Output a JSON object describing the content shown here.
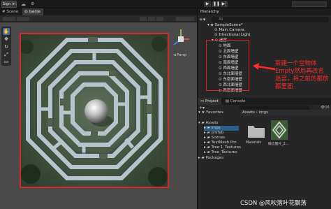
{
  "toolbar": {
    "signin": "Sign in"
  },
  "tabs": {
    "scene": "Scene",
    "game": "Game"
  },
  "hierarchy": {
    "title": "Hierarchy",
    "search_placeholder": "All",
    "items": [
      {
        "label": "SampleScene*"
      },
      {
        "label": "Main Camera"
      },
      {
        "label": "Directional Light"
      },
      {
        "label": "迷宫"
      },
      {
        "label": "地面"
      },
      {
        "label": "北面墙壁"
      },
      {
        "label": "东面墙壁"
      },
      {
        "label": "南面墙壁"
      },
      {
        "label": "西面墙壁"
      },
      {
        "label": "东北面墙壁"
      },
      {
        "label": "东南面墙壁"
      },
      {
        "label": "西北面墙壁"
      },
      {
        "label": "西南面墙壁"
      }
    ]
  },
  "annotation": {
    "text": "新建一个空物体Empty然后再改名迷宫，将之前的都放都里面"
  },
  "project": {
    "tab_project": "Project",
    "tab_console": "Console",
    "favorites": "Favorites",
    "assets": "Assets",
    "folders": [
      "imgs",
      "prefab",
      "Scenes",
      "TextMesh Pro",
      "Tree 1_Textures",
      "Tree_Textures"
    ],
    "packages": "Packages",
    "breadcrumb": "Assets › imgs",
    "count": "16",
    "files": [
      {
        "label": "Materials"
      },
      {
        "label": "微信图片_2..."
      }
    ]
  },
  "watermark": "CSDN @风吹落叶花飘荡"
}
